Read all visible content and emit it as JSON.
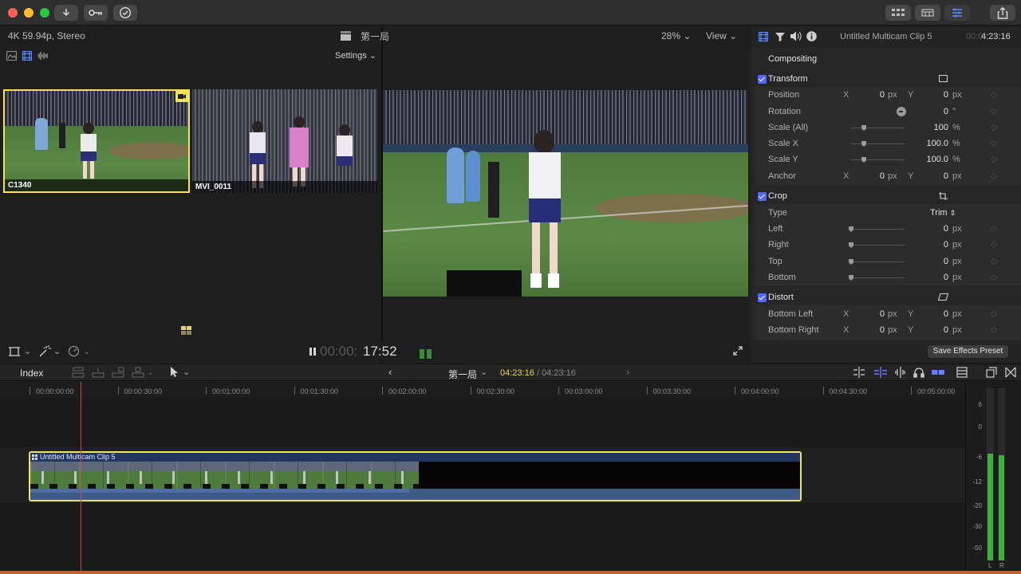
{
  "app": {
    "accent": "#5468ff",
    "selection": "#f4e25a"
  },
  "titlebar": {
    "buttons": [
      "download-icon",
      "key-icon",
      "checkmark-circle-icon"
    ],
    "right_buttons": [
      "grid-icon",
      "video-icon",
      "sliders-icon",
      "share-icon"
    ]
  },
  "browser": {
    "format": "4K 59.94p, Stereo",
    "settings_label": "Settings",
    "angles": [
      {
        "name": "C1340",
        "active": true
      },
      {
        "name": "MVI_0011",
        "active": false
      }
    ]
  },
  "viewer": {
    "title": "第一局",
    "zoom": "28%",
    "view_label": "View",
    "timecode_dim": "00:00:",
    "timecode": "17:52"
  },
  "inspector": {
    "clip_name": "Untitled Multicam Clip 5",
    "duration_dim": "00:0",
    "duration": "4:23:16",
    "compositing": "Compositing",
    "transform": {
      "title": "Transform",
      "position": {
        "label": "Position",
        "x_axis": "X",
        "x": "0",
        "x_unit": "px",
        "y_axis": "Y",
        "y": "0",
        "y_unit": "px"
      },
      "rotation": {
        "label": "Rotation",
        "value": "0",
        "unit": "°"
      },
      "scale_all": {
        "label": "Scale (All)",
        "value": "100",
        "unit": "%"
      },
      "scale_x": {
        "label": "Scale X",
        "value": "100.0",
        "unit": "%"
      },
      "scale_y": {
        "label": "Scale Y",
        "value": "100.0",
        "unit": "%"
      },
      "anchor": {
        "label": "Anchor",
        "x_axis": "X",
        "x": "0",
        "x_unit": "px",
        "y_axis": "Y",
        "y": "0",
        "y_unit": "px"
      }
    },
    "crop": {
      "title": "Crop",
      "type": {
        "label": "Type",
        "value": "Trim"
      },
      "left": {
        "label": "Left",
        "value": "0",
        "unit": "px"
      },
      "right": {
        "label": "Right",
        "value": "0",
        "unit": "px"
      },
      "top": {
        "label": "Top",
        "value": "0",
        "unit": "px"
      },
      "bottom": {
        "label": "Bottom",
        "value": "0",
        "unit": "px"
      }
    },
    "distort": {
      "title": "Distort",
      "bottom_left": {
        "label": "Bottom Left",
        "x_axis": "X",
        "x": "0",
        "x_unit": "px",
        "y_axis": "Y",
        "y": "0",
        "y_unit": "px"
      },
      "bottom_right": {
        "label": "Bottom Right",
        "x_axis": "X",
        "x": "0",
        "x_unit": "px",
        "y_axis": "Y",
        "y": "0",
        "y_unit": "px"
      }
    },
    "save_preset": "Save Effects Preset"
  },
  "timeline": {
    "index_label": "Index",
    "project_name": "第一局",
    "current_time": "04:23:16",
    "separator": "/",
    "total_time": "04:23:16",
    "ruler": [
      "00:00:00:00",
      "00:00:30:00",
      "00:01:00:00",
      "00:01:30:00",
      "00:02:00:00",
      "00:02:30:00",
      "00:03:00:00",
      "00:03:30:00",
      "00:04:00:00",
      "00:04:30:00",
      "00:05:00:00"
    ],
    "clip_name": "Untitled Multicam Clip 5"
  },
  "meters": {
    "scale": [
      "6",
      "0",
      "-6",
      "-12",
      "-20",
      "-30",
      "-50"
    ],
    "left": "L",
    "right": "R"
  }
}
